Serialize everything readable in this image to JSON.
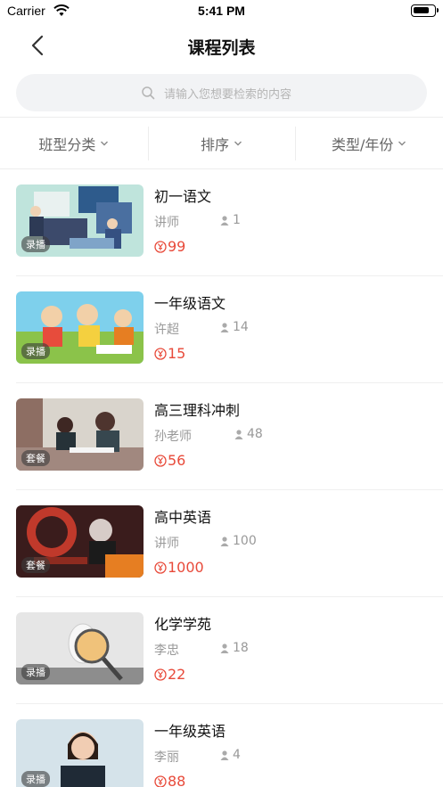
{
  "status_bar": {
    "carrier": "Carrier",
    "time": "5:41 PM",
    "battery_level": 0.8
  },
  "nav": {
    "title": "课程列表"
  },
  "search": {
    "placeholder": "请输入您想要检索的内容"
  },
  "filters": [
    {
      "label": "班型分类"
    },
    {
      "label": "排序"
    },
    {
      "label": "类型/年份"
    }
  ],
  "courses": [
    {
      "title": "初一语文",
      "teacher": "讲师",
      "students": "1",
      "price": "99",
      "tag": "录播"
    },
    {
      "title": "一年级语文",
      "teacher": "许超",
      "students": "14",
      "price": "15",
      "tag": "录播"
    },
    {
      "title": "高三理科冲刺",
      "teacher": "孙老师",
      "students": "48",
      "price": "56",
      "tag": "套餐"
    },
    {
      "title": "高中英语",
      "teacher": "讲师",
      "students": "100",
      "price": "1000",
      "tag": "套餐"
    },
    {
      "title": "化学学苑",
      "teacher": "李忠",
      "students": "18",
      "price": "22",
      "tag": "录播"
    },
    {
      "title": "一年级英语",
      "teacher": "李丽",
      "students": "4",
      "price": "88",
      "tag": "录播"
    }
  ],
  "colors": {
    "price": "#e84a3a",
    "search_bg": "#f2f3f5"
  },
  "icons": {
    "back": "chevron-left-icon",
    "search": "search-icon",
    "person": "person-icon",
    "coin": "coin-icon"
  }
}
